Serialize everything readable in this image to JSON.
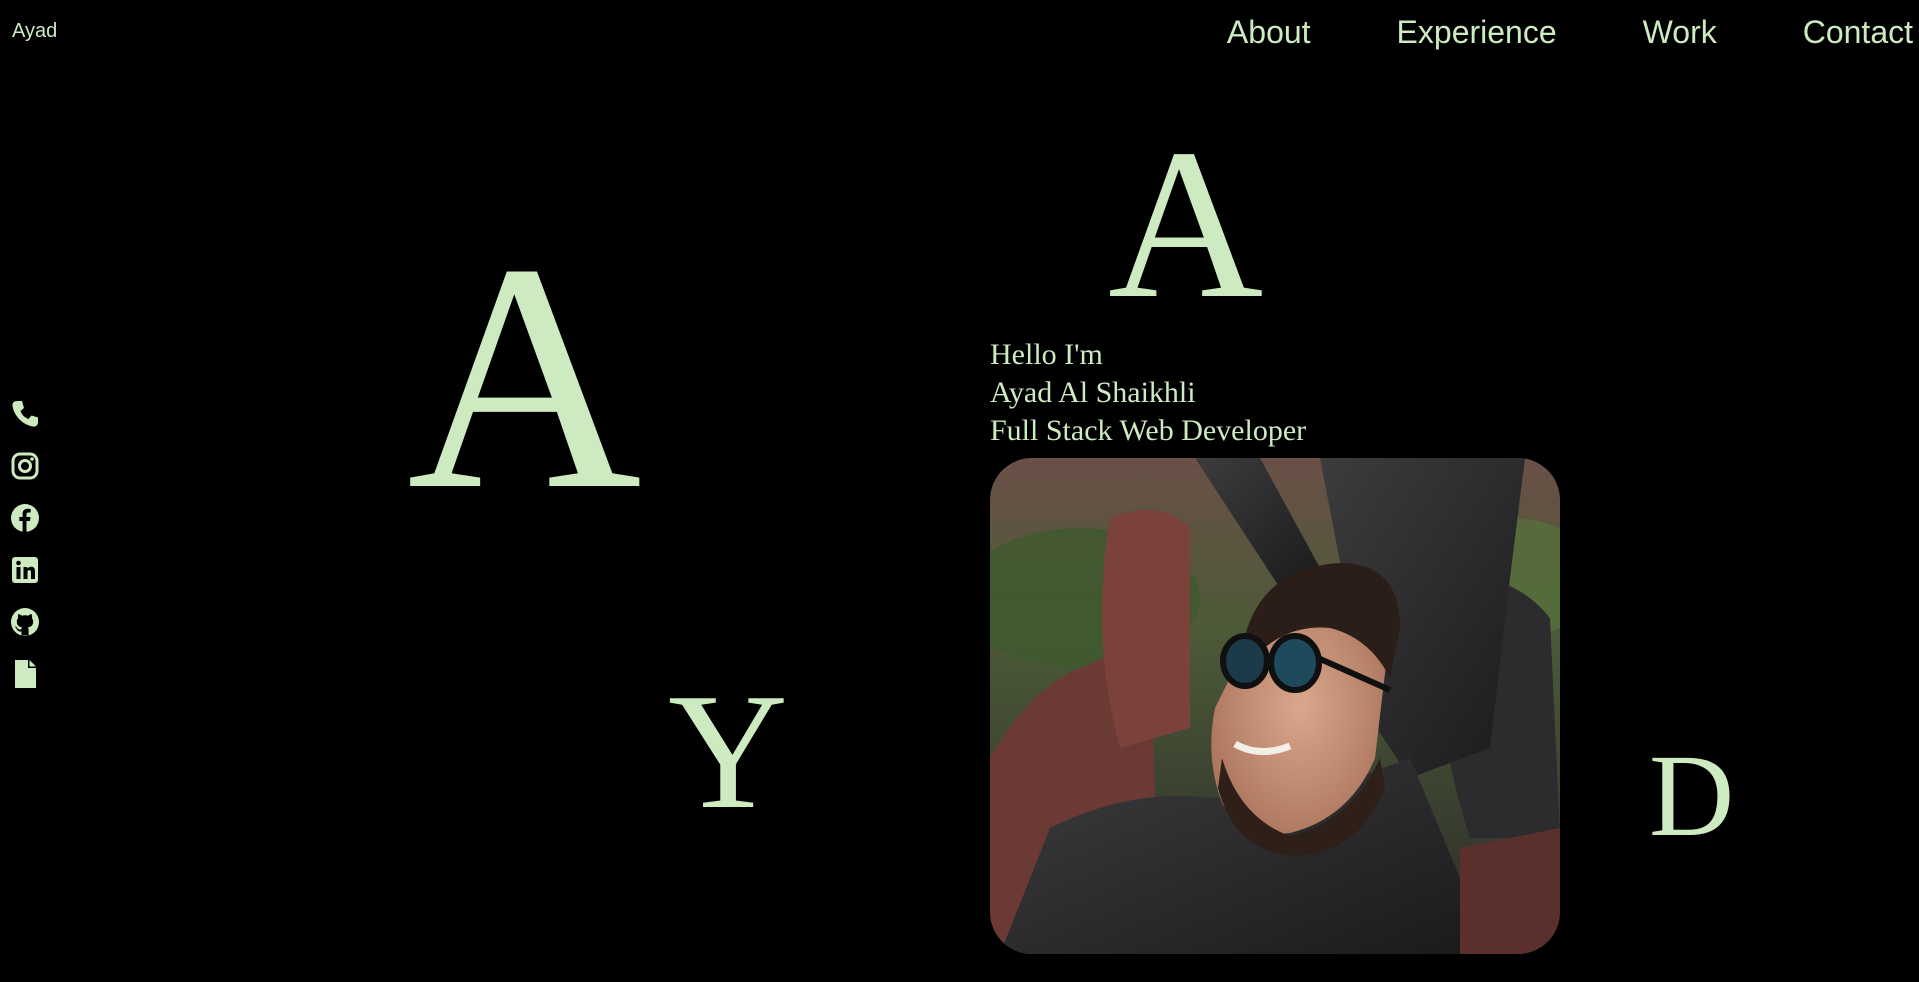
{
  "header": {
    "brand": "Ayad",
    "nav": {
      "about": "About",
      "experience": "Experience",
      "work": "Work",
      "contact": "Contact"
    }
  },
  "decor_letters": {
    "a1": "A",
    "a2": "A",
    "y": "Y",
    "d": "D"
  },
  "socials": [
    {
      "icon": "phone-icon"
    },
    {
      "icon": "instagram-icon"
    },
    {
      "icon": "facebook-icon"
    },
    {
      "icon": "linkedin-icon"
    },
    {
      "icon": "github-icon"
    },
    {
      "icon": "document-icon"
    }
  ],
  "hero": {
    "greeting": "Hello I'm",
    "name": "Ayad Al Shaikhli",
    "role": "Full Stack Web Developer"
  },
  "colors": {
    "background": "#000000",
    "accent": "#cdeac0"
  }
}
